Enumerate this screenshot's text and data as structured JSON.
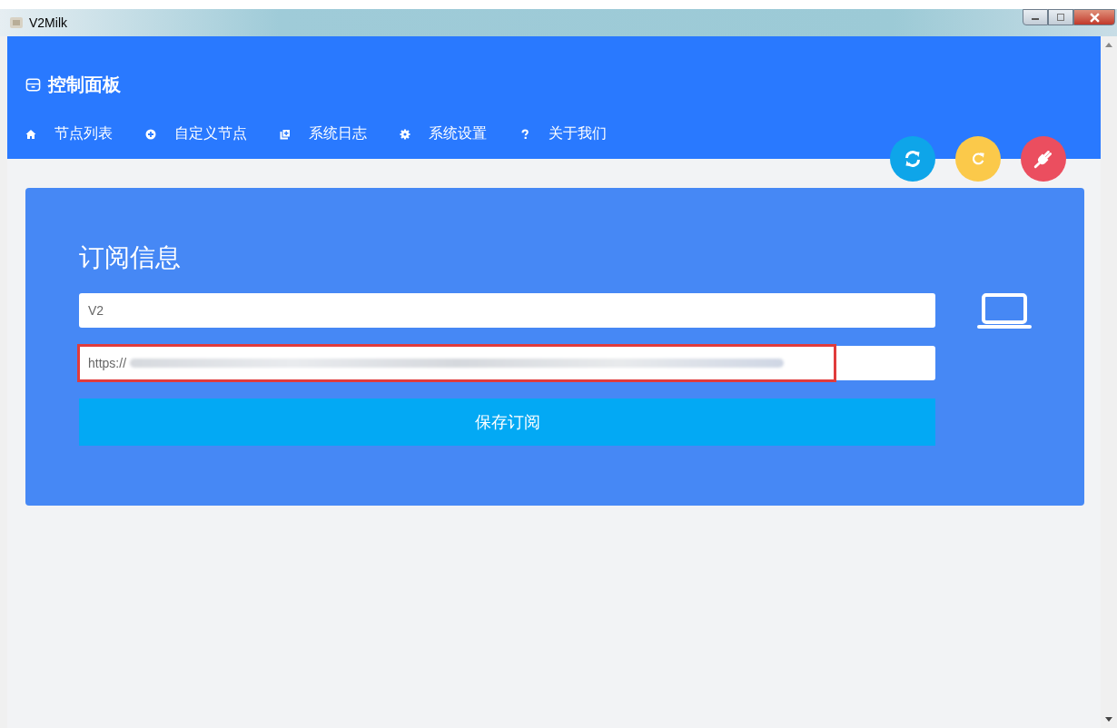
{
  "window": {
    "title": "V2Milk"
  },
  "header": {
    "title": "控制面板"
  },
  "nav": [
    {
      "label": "节点列表"
    },
    {
      "label": "自定义节点"
    },
    {
      "label": "系统日志"
    },
    {
      "label": "系统设置"
    },
    {
      "label": "关于我们"
    }
  ],
  "actions": [
    {
      "color": "#0ea5e9"
    },
    {
      "color": "#fbc94a"
    },
    {
      "color": "#eb4e5f"
    }
  ],
  "card": {
    "title": "订阅信息",
    "name_field": {
      "value": "V2"
    },
    "url_field": {
      "value": "https://",
      "highlighted": true
    },
    "save_button": "保存订阅"
  }
}
